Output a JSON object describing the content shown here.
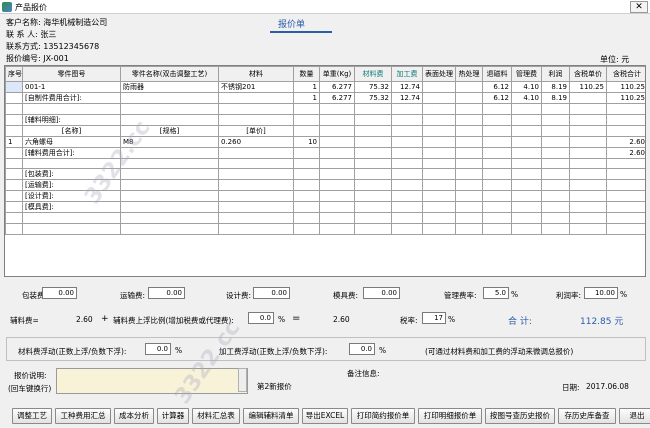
{
  "window": {
    "title": "产品报价",
    "close": "✕"
  },
  "header": {
    "customer_name": "客户名称: 海华机械制造公司",
    "contact": "联 系 人: 张三",
    "phone": "联系方式: 13512345678",
    "quote_no": "报价编号: JX-001",
    "report_title": "报价单",
    "unit": "单位: 元"
  },
  "table": {
    "columns": [
      "序号",
      "零件图号",
      "零件名称(双击调整工艺)",
      "材料",
      "数量",
      "单重(Kg)",
      "材料费",
      "加工费",
      "表面处理",
      "热处理",
      "退磁料",
      "管理费",
      "利润",
      "含税单价",
      "含税合计"
    ],
    "rows": [
      [
        "",
        "001-1",
        "防雨器",
        "不锈钢201",
        "1",
        "6.277",
        "75.32",
        "12.74",
        "",
        "",
        "6.12",
        "4.10",
        "8.19",
        "110.25",
        "110.25"
      ],
      [
        "",
        "[自制件费用合计]:",
        "",
        "",
        "1",
        "6.277",
        "75.32",
        "12.74",
        "",
        "",
        "6.12",
        "4.10",
        "8.19",
        "",
        "110.25"
      ],
      [
        "",
        "",
        "",
        "",
        "",
        "",
        "",
        "",
        "",
        "",
        "",
        "",
        "",
        "",
        ""
      ],
      [
        "",
        "[辅料明细]:",
        "",
        "",
        "",
        "",
        "",
        "",
        "",
        "",
        "",
        "",
        "",
        "",
        ""
      ],
      [
        "",
        "[名称]",
        "[规格]",
        "[单价]",
        "",
        "",
        "",
        "",
        "",
        "",
        "",
        "",
        "",
        "",
        ""
      ],
      [
        "1",
        "六角螺母",
        "M8",
        "0.260",
        "10",
        "",
        "",
        "",
        "",
        "",
        "",
        "",
        "",
        "",
        "2.60"
      ],
      [
        "",
        "[辅料费用合计]:",
        "",
        "",
        "",
        "",
        "",
        "",
        "",
        "",
        "",
        "",
        "",
        "",
        "2.60"
      ],
      [
        "",
        "",
        "",
        "",
        "",
        "",
        "",
        "",
        "",
        "",
        "",
        "",
        "",
        "",
        ""
      ],
      [
        "",
        "[包装费]:",
        "",
        "",
        "",
        "",
        "",
        "",
        "",
        "",
        "",
        "",
        "",
        "",
        ""
      ],
      [
        "",
        "[运输费]:",
        "",
        "",
        "",
        "",
        "",
        "",
        "",
        "",
        "",
        "",
        "",
        "",
        ""
      ],
      [
        "",
        "[设计费]:",
        "",
        "",
        "",
        "",
        "",
        "",
        "",
        "",
        "",
        "",
        "",
        "",
        ""
      ],
      [
        "",
        "[模具费]:",
        "",
        "",
        "",
        "",
        "",
        "",
        "",
        "",
        "",
        "",
        "",
        "",
        ""
      ],
      [
        "",
        "",
        "",
        "",
        "",
        "",
        "",
        "",
        "",
        "",
        "",
        "",
        "",
        "",
        ""
      ],
      [
        "",
        "",
        "",
        "",
        "",
        "",
        "",
        "",
        "",
        "",
        "",
        "",
        "",
        "",
        ""
      ]
    ]
  },
  "fees": {
    "packing_label": "包装费:",
    "packing": "0.00",
    "transport_label": "运输费:",
    "transport": "0.00",
    "design_label": "设计费:",
    "design": "0.00",
    "mold_label": "模具费:",
    "mold": "0.00",
    "mgmt_label": "管理费率:",
    "mgmt": "5.0",
    "pct": "%",
    "profit_label": "利润率:",
    "profit": "10.00"
  },
  "summary": {
    "aux_label": "辅料费=",
    "aux_value": "2.60",
    "plus": "+",
    "float_label": "辅料费上浮比例(增加税费或代理费):",
    "float_value": "0.0",
    "eq": "=",
    "aux_total": "2.60",
    "tax_label": "税率:",
    "tax_value": "17",
    "total_label": "合 计:",
    "total_value": "112.85 元"
  },
  "floats": {
    "mat_label": "材料费浮动(正数上浮/负数下浮):",
    "mat_value": "0.0",
    "proc_label": "加工费浮动(正数上浮/负数下浮):",
    "proc_value": "0.0",
    "hint": "(可通过材料费和加工费的浮动来微调总报价)"
  },
  "notes": {
    "desc_label": "报价说明:",
    "desc_sub": "(回车键换行)",
    "remark_label": "备注信息:",
    "remark_value": "第2新报价",
    "date_label": "日期:",
    "date_value": "2017.06.08"
  },
  "buttons": [
    "调整工艺",
    "工种费用汇总",
    "成本分析",
    "计算器",
    "材料汇总表",
    "编辑辅料清单",
    "导出EXCEL",
    "打印简约报价单",
    "打印明细报价单",
    "按图号查历史报价",
    "存历史库备查",
    "退出"
  ],
  "watermark": "3322.cc"
}
